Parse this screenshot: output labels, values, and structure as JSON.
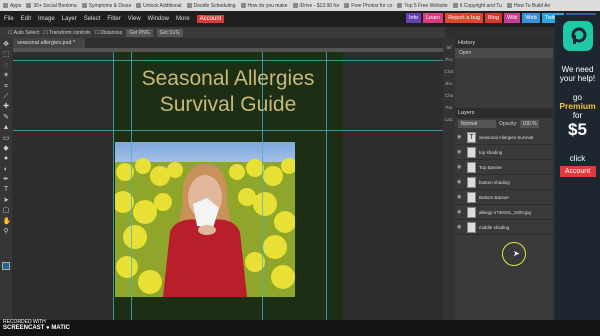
{
  "bookmarks": [
    "Apps",
    "30+ Social Bookma",
    "Symptoms & Disea",
    "Unlock Additional",
    "Doodle Scheduling",
    "How do you make",
    "iDrive - $13.90 for",
    "Free Photos for co",
    "Top 5 Free Website",
    "6 Copyright and Tu",
    "How To Build An"
  ],
  "menubar": {
    "items": [
      "File",
      "Edit",
      "Image",
      "Layer",
      "Select",
      "Filter",
      "View",
      "Window",
      "More"
    ],
    "account": "Account",
    "social": [
      {
        "label": "Info",
        "color": "#6a3fb5"
      },
      {
        "label": "Learn",
        "color": "#d93b7c"
      },
      {
        "label": "Report a bug",
        "color": "#d84a2d"
      },
      {
        "label": "Blog",
        "color": "#d9362e"
      },
      {
        "label": "Wiki",
        "color": "#c63c8e"
      },
      {
        "label": "Web",
        "color": "#3b8fd6"
      },
      {
        "label": "Twitter",
        "color": "#2aa3e3"
      },
      {
        "label": "Facebook",
        "color": "#3b5ba0"
      }
    ]
  },
  "options": {
    "auto_select": "Auto Select",
    "transform": "Transform controls",
    "distances": "Distances",
    "btn1": "Get PNG",
    "btn2": "Get SVG"
  },
  "doc_tab": "seasonal allergies.psd *",
  "canvas": {
    "title_line1": "Seasonal Allergies",
    "title_line2": "Survival Guide"
  },
  "side_nav": [
    "Inf",
    "Pro",
    "CSS",
    "Bru",
    "Cha",
    "Par",
    "LaC"
  ],
  "history": {
    "title": "History",
    "items": [
      "Open"
    ]
  },
  "layers": {
    "title": "Layers",
    "blend": "Normal",
    "opacity_label": "Opacity:",
    "opacity_value": "100 %",
    "items": [
      {
        "name": "Seasonal Allergies Survival",
        "thumb": "T"
      },
      {
        "name": "top shading",
        "thumb": ""
      },
      {
        "name": "Top Banner",
        "thumb": ""
      },
      {
        "name": "bottom shading",
        "thumb": ""
      },
      {
        "name": "Bottom Banner",
        "thumb": ""
      },
      {
        "name": "allergy-1738191_1920.jpg",
        "thumb": ""
      },
      {
        "name": "middle shading",
        "thumb": ""
      }
    ]
  },
  "ad": {
    "line1": "We need",
    "line2": "your help!",
    "go": "go",
    "premium": "Premium",
    "for": "for",
    "price": "$5",
    "click": "click",
    "account_btn": "Account",
    "accent": "#1ec9a8",
    "price_color": "#f3c13a"
  },
  "watermark": {
    "line1": "RECORDED WITH",
    "line2": "SCREENCAST",
    "line3": "MATIC"
  }
}
